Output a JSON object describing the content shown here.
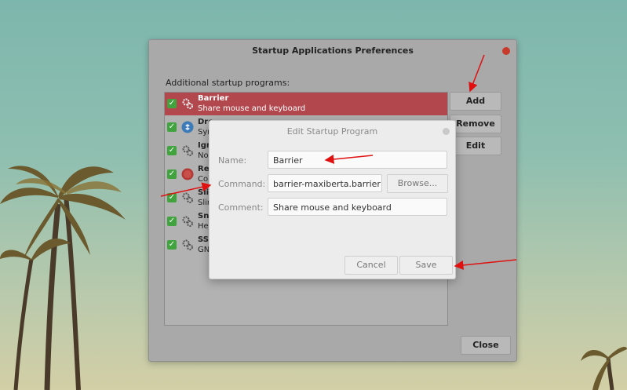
{
  "main_window": {
    "title": "Startup Applications Preferences",
    "section_label": "Additional startup programs:",
    "buttons": {
      "add": "Add",
      "remove": "Remove",
      "edit": "Edit",
      "close": "Close"
    },
    "items": [
      {
        "name": "Barrier",
        "desc": "Share mouse and keyboard",
        "checked": true,
        "icon": "gears-icon",
        "selected": true
      },
      {
        "name": "Dro",
        "desc": "Syn",
        "checked": true,
        "icon": "dropbox-icon",
        "selected": false
      },
      {
        "name": "Ign",
        "desc": "No",
        "checked": true,
        "icon": "gears-icon",
        "selected": false
      },
      {
        "name": "Re",
        "desc": "Col",
        "checked": true,
        "icon": "redshift-icon",
        "selected": false
      },
      {
        "name": "Slir",
        "desc": "Slir",
        "checked": true,
        "icon": "gears-icon",
        "selected": false
      },
      {
        "name": "Sna",
        "desc": "Hel",
        "checked": true,
        "icon": "gears-icon",
        "selected": false
      },
      {
        "name": "SSI",
        "desc": "GN",
        "checked": true,
        "icon": "gears-icon",
        "selected": false
      }
    ]
  },
  "edit_dialog": {
    "title": "Edit Startup Program",
    "name_label": "Name:",
    "name_value": "Barrier",
    "command_label": "Command:",
    "command_value": "barrier-maxiberta.barrier",
    "comment_label": "Comment:",
    "comment_value": "Share mouse and keyboard",
    "browse_label": "Browse...",
    "cancel_label": "Cancel",
    "save_label": "Save"
  },
  "colors": {
    "selection": "#b2484e",
    "check": "#41a33d",
    "annotation_arrow": "#e01010",
    "close_dot": "#c83a2c"
  }
}
